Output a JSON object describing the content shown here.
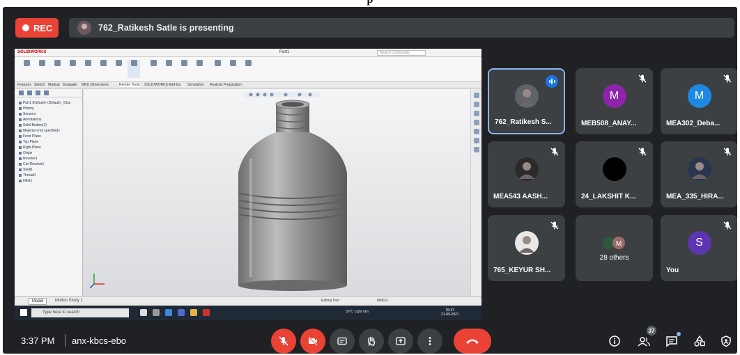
{
  "caption_fragment": "p",
  "recording": {
    "label": "REC"
  },
  "presenter_banner": {
    "text": "762_Ratikesh Satle is presenting"
  },
  "shared_screen": {
    "app": "SOLIDWORKS",
    "document": "Part1",
    "search_placeholder": "Search Commands",
    "command_tabs": [
      "Features",
      "Sketch",
      "Markup",
      "Evaluate",
      "MBD Dimensions",
      "Render Tools",
      "SOLIDWORKS Add-Ins",
      "Simulation",
      "Analysis Preparation"
    ],
    "tree_items": [
      "Part1 (Default<<Default>_Disp",
      "History",
      "Sensors",
      "Annotations",
      "Solid Bodies(1)",
      "Material <not specified>",
      "Front Plane",
      "Top Plane",
      "Right Plane",
      "Origin",
      "Revolve1",
      "Cut-Revolve1",
      "Shell1",
      "Thread1",
      "Fillet1"
    ],
    "model_tabs": [
      "Model",
      "Motion Study 1"
    ],
    "taskbar_search": "Type here to search",
    "tray_text": "30°C Light rain",
    "clock": [
      "15:37",
      "21-09-2021"
    ],
    "status_units": "MMGS",
    "status_label": "Editing Part"
  },
  "participants": [
    {
      "name": "762_Ratikesh S...",
      "avatar": "photo",
      "active": true,
      "speaking": true,
      "muted": false,
      "color": "#5f6368"
    },
    {
      "name": "MEB508_ANAY...",
      "avatar": "M",
      "muted": true,
      "color": "#8e24aa"
    },
    {
      "name": "MEA302_Deba...",
      "avatar": "M",
      "muted": true,
      "color": "#1e88e5"
    },
    {
      "name": "MEA543 AASH...",
      "avatar": "photo",
      "muted": true,
      "color": "#2b2b2b"
    },
    {
      "name": "24_LAKSHIT K...",
      "avatar": "",
      "muted": true,
      "color": "#000000"
    },
    {
      "name": "MEA_335_HIRA...",
      "avatar": "photo",
      "muted": true,
      "color": "#2a3550"
    },
    {
      "name": "765_KEYUR SH...",
      "avatar": "photo",
      "muted": true,
      "color": "#e8e8e8"
    },
    {
      "name": "28 others",
      "avatar": "group",
      "muted": false,
      "color": "#5f6368"
    },
    {
      "name": "You",
      "avatar": "S",
      "muted": true,
      "color": "#5e35b1"
    }
  ],
  "bottom_bar": {
    "time": "3:37 PM",
    "meeting_code": "anx-kbcs-ebo",
    "people_count": "37"
  },
  "colors": {
    "background": "#202124",
    "tile": "#3c4043",
    "red": "#ea4335",
    "accent": "#8ab4f8"
  }
}
